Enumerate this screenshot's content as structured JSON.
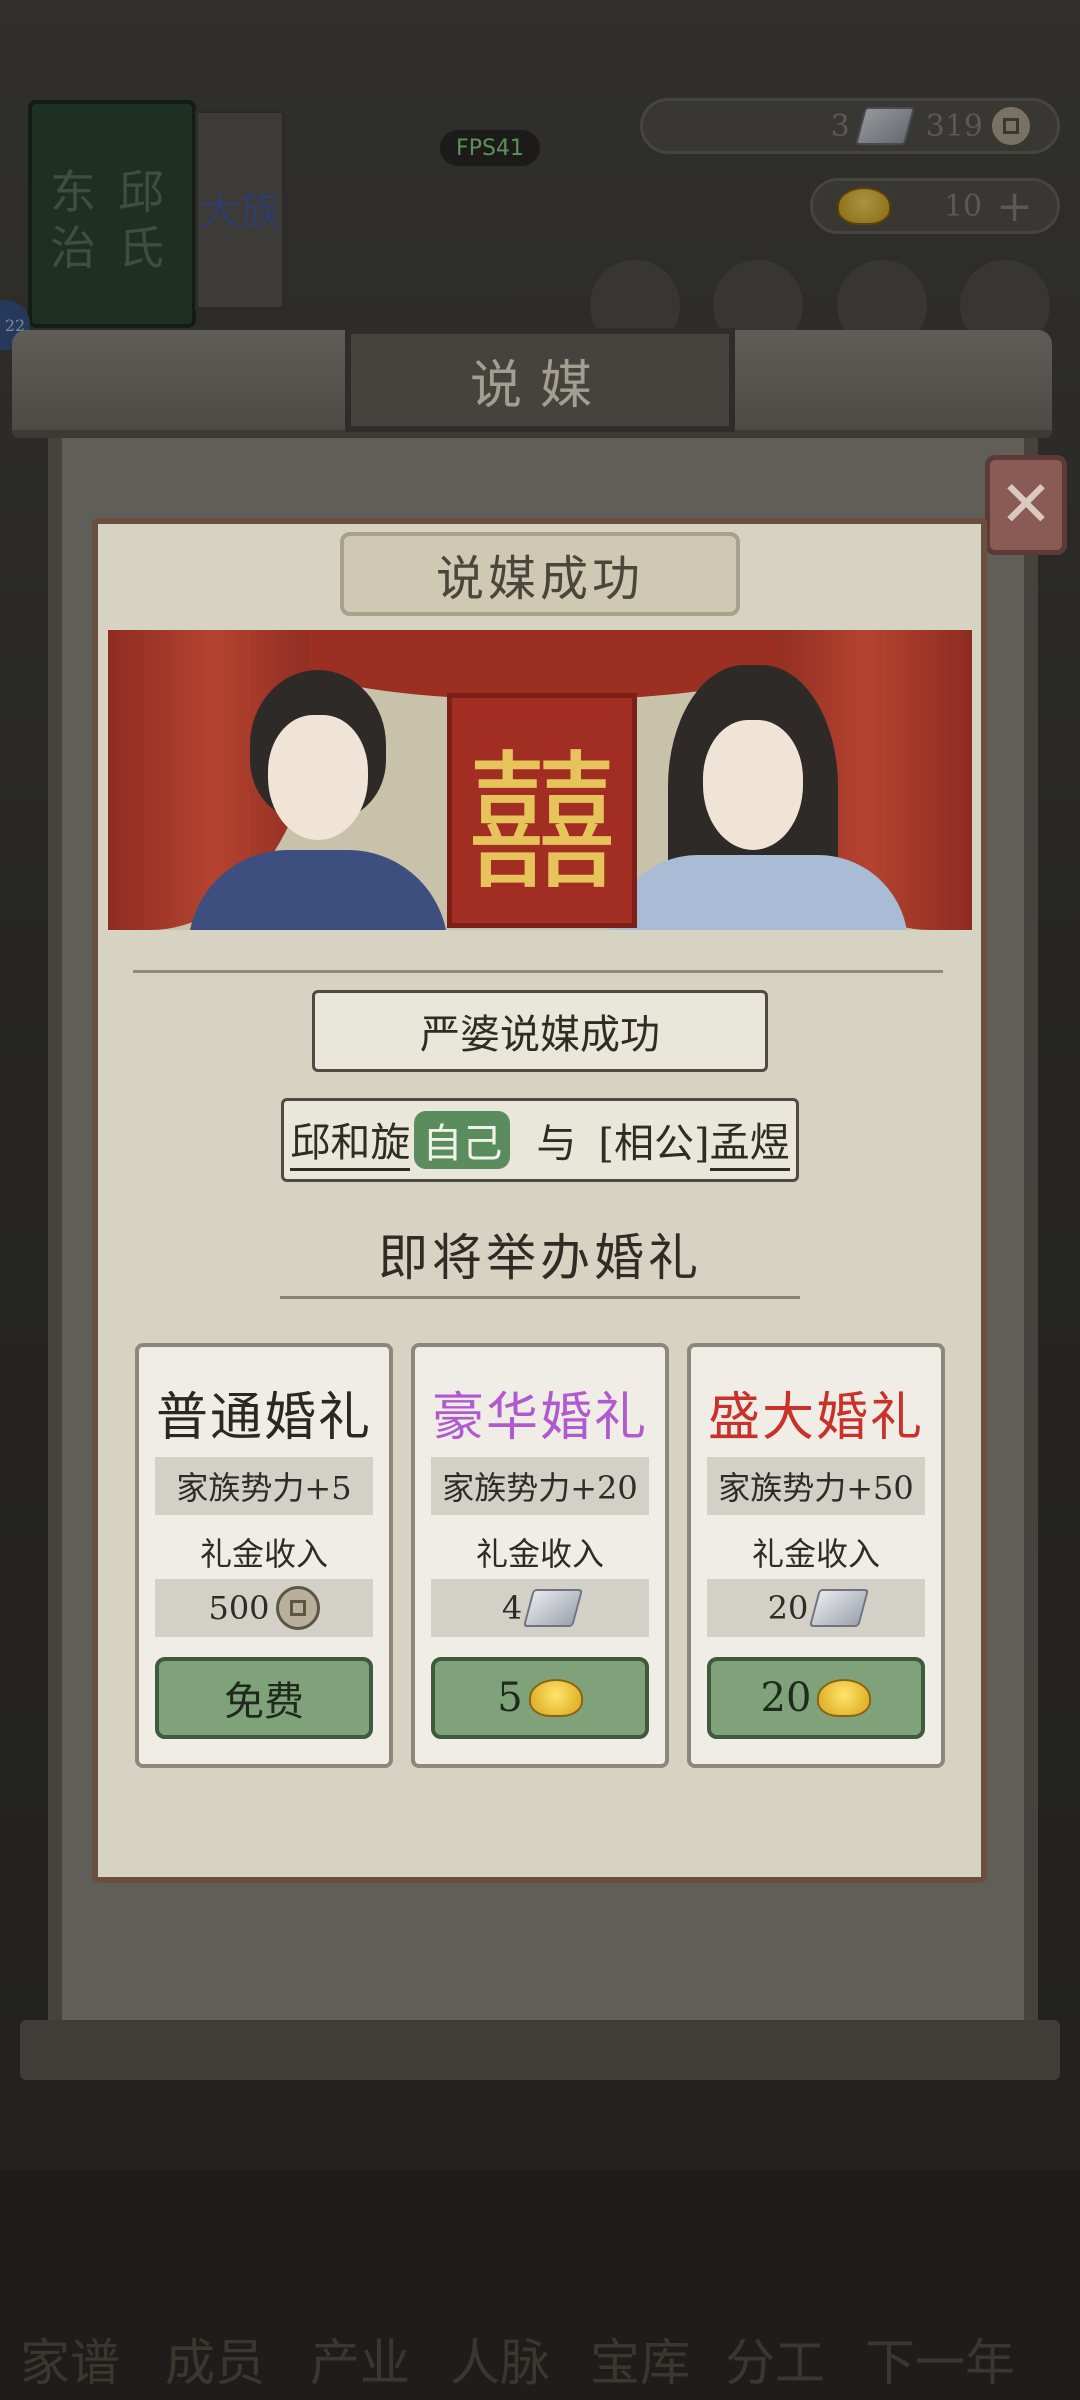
{
  "hud": {
    "fps": "FPS41",
    "silver_count": "3",
    "coin_count": "319",
    "gold_count": "10",
    "family_name_tab": "东治",
    "family_name_tab2": "邱氏",
    "clan_label": "大族",
    "level_badge": "22"
  },
  "modal": {
    "title": "说媒",
    "result_banner": "说媒成功",
    "double_happiness": "囍",
    "matchmaker_message": "严婆说媒成功",
    "couple": {
      "bride_name": "邱和旋",
      "self_tag": "自己",
      "connector": "与",
      "groom_prefix": "[相公]",
      "groom_name": "孟煜"
    },
    "upcoming_text": "即将举办婚礼"
  },
  "wedding_options": [
    {
      "title": "普通婚礼",
      "title_color": "#2b2824",
      "influence": "家族势力+5",
      "income_label": "礼金收入",
      "income_value": "500",
      "income_icon": "copper-coin-icon",
      "cost_label": "免费",
      "cost_icon": ""
    },
    {
      "title": "豪华婚礼",
      "title_color": "#b05ad0",
      "influence": "家族势力+20",
      "income_label": "礼金收入",
      "income_value": "4",
      "income_icon": "silver-ingot-icon",
      "cost_label": "5",
      "cost_icon": "gold-ingot-icon"
    },
    {
      "title": "盛大婚礼",
      "title_color": "#c8322b",
      "influence": "家族势力+50",
      "income_label": "礼金收入",
      "income_value": "20",
      "income_icon": "silver-ingot-icon",
      "cost_label": "20",
      "cost_icon": "gold-ingot-icon"
    }
  ],
  "bottom_nav": [
    "家谱",
    "成员",
    "产业",
    "人脉",
    "宝库",
    "分工",
    "下一年"
  ]
}
